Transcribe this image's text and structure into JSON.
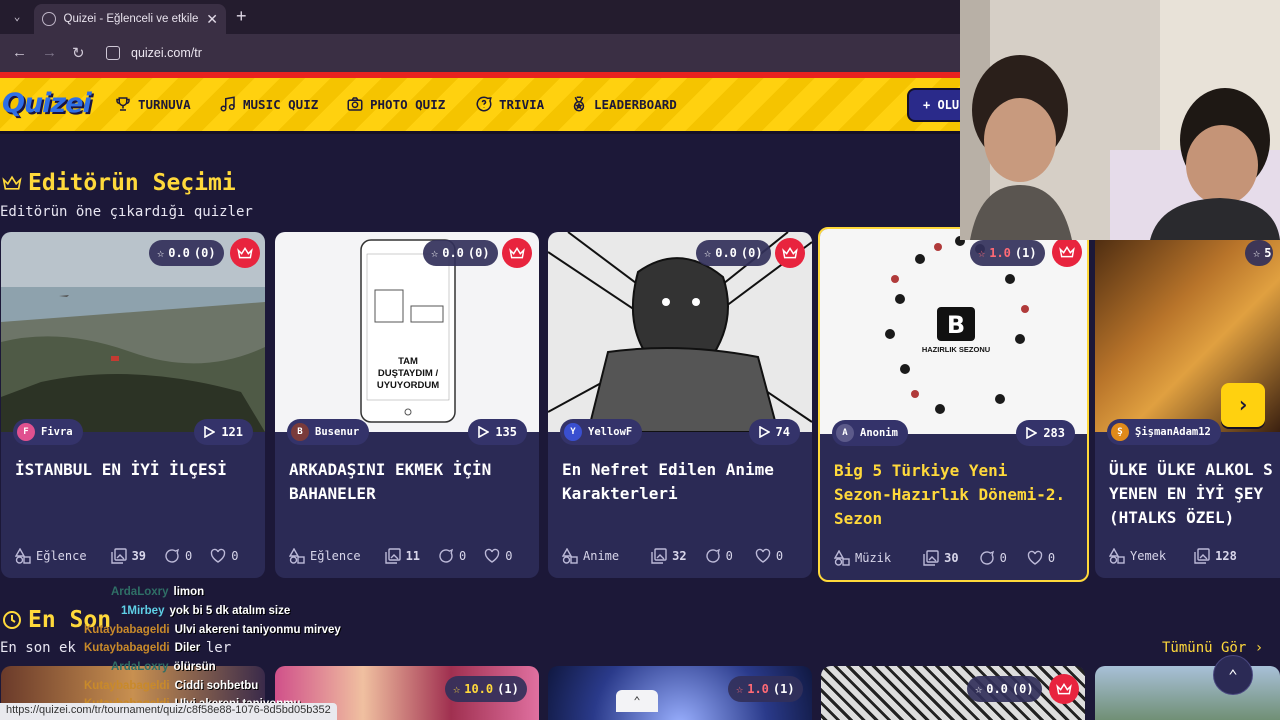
{
  "browser": {
    "tab_title": "Quizei - Eğlenceli ve etkileşimli",
    "url": "quizei.com/tr",
    "status_url": "https://quizei.com/tr/tournament/quiz/c8f58e88-1076-8d5bd05b352"
  },
  "header": {
    "logo": "Quizei",
    "nav": [
      {
        "label": "TURNUVA",
        "icon": "trophy-icon"
      },
      {
        "label": "MUSIC QUIZ",
        "icon": "music-note-icon"
      },
      {
        "label": "PHOTO QUIZ",
        "icon": "camera-icon"
      },
      {
        "label": "TRIVIA",
        "icon": "question-bubble-icon"
      },
      {
        "label": "LEADERBOARD",
        "icon": "medal-icon"
      }
    ],
    "create_button": "+ OLU"
  },
  "editors_pick": {
    "title": "Editörün Seçimi",
    "subtitle": "Editörün öne çıkardığı quizler",
    "cards": [
      {
        "rating": "0.0",
        "rating_count": "(0)",
        "author": "Fivra",
        "author_initial": "F",
        "plays": "121",
        "title": "İSTANBUL EN İYİ İLÇESİ",
        "category": "Eğlence",
        "questions": "39",
        "comments": "0",
        "likes": "0"
      },
      {
        "rating": "0.0",
        "rating_count": "(0)",
        "author": "Busenur",
        "author_initial": "B",
        "plays": "135",
        "title": "ARKADAŞINI EKMEK İÇİN BAHANELER",
        "category": "Eğlence",
        "questions": "11",
        "comments": "0",
        "likes": "0",
        "image_text": "TAM DUŞTAYDIM / UYUYORDUM"
      },
      {
        "rating": "0.0",
        "rating_count": "(0)",
        "author": "YellowF",
        "author_initial": "Y",
        "plays": "74",
        "title": "En Nefret Edilen Anime Karakterleri",
        "category": "Anime",
        "questions": "32",
        "comments": "0",
        "likes": "0"
      },
      {
        "rating": "1.0",
        "rating_count": "(1)",
        "author": "Anonim",
        "author_initial": "A",
        "plays": "283",
        "title": "Big 5 Türkiye Yeni Sezon-Hazırlık Dönemi-2. Sezon",
        "category": "Müzik",
        "questions": "30",
        "comments": "0",
        "likes": "0",
        "image_text": "HAZIRLIK SEZONU"
      },
      {
        "rating": "5",
        "author": "ŞişmanAdam12",
        "author_initial": "Ş",
        "title": "ÜLKE ÜLKE ALKOL S YENEN EN İYİ ŞEY (HTALKS ÖZEL)",
        "category": "Yemek",
        "questions": "128"
      }
    ]
  },
  "latest": {
    "title": "En Son",
    "subtitle_visible": "En son ek",
    "subtitle_tail": "ler",
    "see_all": "Tümünü Gör ›",
    "ratings": [
      {
        "rating": "10.0",
        "count": "(1)"
      },
      {
        "rating": "1.0",
        "count": "(1)"
      },
      {
        "rating": "0.0",
        "count": "(0)"
      }
    ]
  },
  "chat": [
    {
      "user": "ArdaLoxry",
      "color": "#2f6f66",
      "msg": "limon"
    },
    {
      "user": "1Mirbey",
      "color": "#5fd0e6",
      "msg": "yok bi 5 dk atalım size"
    },
    {
      "user": "Kutaybabageldi",
      "color": "#c98a2a",
      "msg": "Ulvi akereni taniyonmu mirvey"
    },
    {
      "user": "Kutaybabageldi",
      "color": "#c98a2a",
      "msg": "Diler"
    },
    {
      "user": "ArdaLoxry",
      "color": "#2f6f66",
      "msg": "ölürsün"
    },
    {
      "user": "Kutaybabageldi",
      "color": "#c98a2a",
      "msg": "Ciddi sohbetbu"
    },
    {
      "user": "Kutaybabageldi",
      "color": "#c98a2a",
      "msg": "Ulvi akereni taniyonmu"
    }
  ]
}
